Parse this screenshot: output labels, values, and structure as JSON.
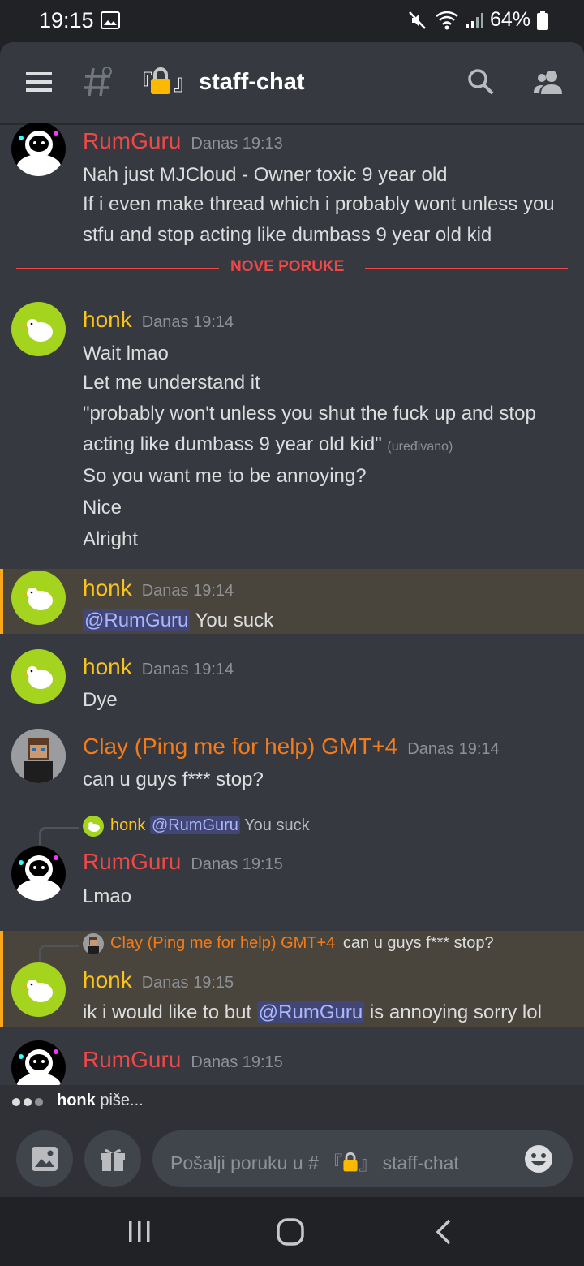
{
  "status_bar": {
    "time": "19:15",
    "battery": "64%"
  },
  "header": {
    "bracket_open": "『",
    "bracket_close": "』",
    "channel_name": "staff-chat"
  },
  "divider": {
    "label": "NOVE PORUKE"
  },
  "messages": [
    {
      "author": "RumGuru",
      "timestamp": "Danas 19:13",
      "lines": [
        "Nah just MJCloud - Owner toxic 9 year old",
        "If i even make thread which i probably wont unless you",
        "stfu and stop acting like dumbass 9 year old kid"
      ]
    },
    {
      "author": "honk",
      "timestamp": "Danas 19:14",
      "lines": [
        "Wait lmao",
        "Let me understand it",
        "\"probably won't unless you shut the fuck up and stop",
        "acting like dumbass 9 year old kid\"",
        "So you want me to be annoying?",
        "Nice",
        "Alright"
      ],
      "edited": "(uređivano)"
    },
    {
      "author": "honk",
      "timestamp": "Danas 19:14",
      "mention": "@RumGuru",
      "text": "You suck"
    },
    {
      "author": "honk",
      "timestamp": "Danas 19:14",
      "text": "Dye"
    },
    {
      "author": "Clay (Ping me for help) GMT+4",
      "timestamp": "Danas 19:14",
      "text": "can u guys f*** stop?"
    },
    {
      "reply_author": "honk",
      "reply_mention": "@RumGuru",
      "reply_text": "You suck",
      "author": "RumGuru",
      "timestamp": "Danas 19:15",
      "text": "Lmao"
    },
    {
      "reply_author": "Clay (Ping me for help) GMT+4",
      "reply_text": "can u guys f*** stop?",
      "author": "honk",
      "timestamp": "Danas 19:15",
      "text_before": "ik i would like to but",
      "mention": "@RumGuru",
      "text_after": "is annoying sorry lol"
    },
    {
      "author": "RumGuru",
      "timestamp": "Danas 19:15"
    }
  ],
  "typing": {
    "user": "honk",
    "text": "piše..."
  },
  "composer": {
    "placeholder_prefix": "Pošalji poruku u #",
    "placeholder_channel": "staff-chat"
  },
  "colors": {
    "rumguru": "#f04747",
    "honk": "#fcc419",
    "clay": "#f47b1a",
    "background": "#36393f",
    "highlight": "#49443c",
    "mention": "#414675"
  },
  "icons": [
    "menu-icon",
    "channel-hash-icon",
    "lock-icon",
    "search-icon",
    "members-icon",
    "image-icon",
    "gift-icon",
    "emoji-icon",
    "recents-icon",
    "home-icon",
    "back-icon"
  ]
}
